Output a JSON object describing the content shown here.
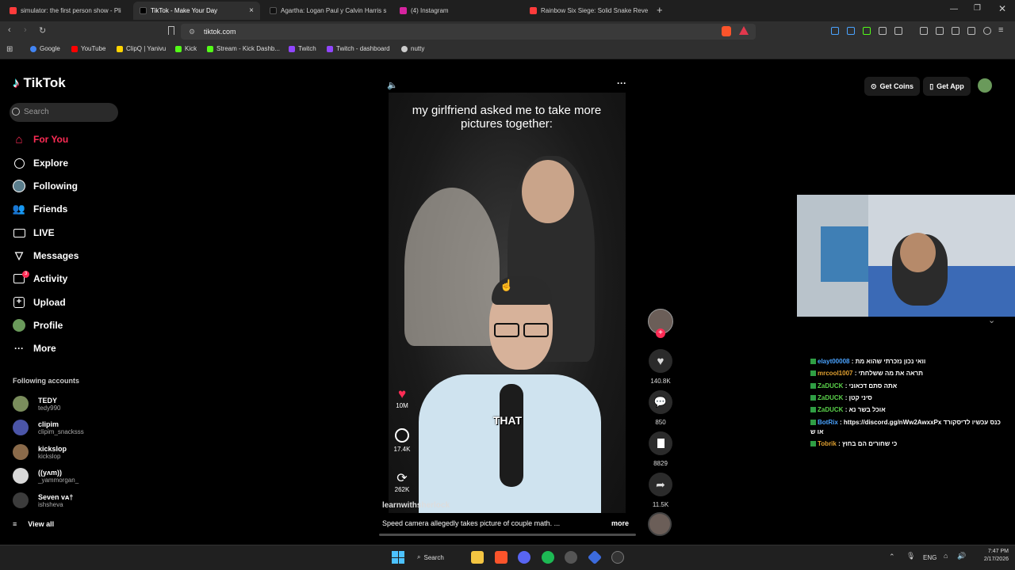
{
  "tabs": [
    {
      "title": "simulator: the first person show - Pli",
      "color": "#ff3b3b"
    },
    {
      "title": "TikTok - Make Your Day",
      "color": "#111"
    },
    {
      "title": "Agartha: Logan Paul y Calvin Harris s",
      "color": "#111"
    },
    {
      "title": "(4) Instagram",
      "color": "#d6249f"
    },
    {
      "title": "Rainbow Six Siege: Solid Snake Reve",
      "color": "#ff3b3b"
    }
  ],
  "tab_close": "×",
  "new_tab": "+",
  "address": {
    "url": "tiktok.com"
  },
  "bookmarks": [
    {
      "label": "Google",
      "color": "#4285f4"
    },
    {
      "label": "YouTube",
      "color": "#ff0000"
    },
    {
      "label": "ClipQ | Yanivu",
      "color": "#ffd400"
    },
    {
      "label": "Kick",
      "color": "#53fc18"
    },
    {
      "label": "Stream - Kick Dashb...",
      "color": "#53fc18"
    },
    {
      "label": "Twitch",
      "color": "#9146ff"
    },
    {
      "label": "Twitch - dashboard",
      "color": "#9146ff"
    },
    {
      "label": "nutty",
      "color": "#cccccc"
    }
  ],
  "tiktok": {
    "logo": "TikTok",
    "search_placeholder": "Search",
    "nav": [
      {
        "label": "For You",
        "icon": "home-icon",
        "active": true
      },
      {
        "label": "Explore",
        "icon": "compass-icon"
      },
      {
        "label": "Following",
        "icon": "following-avatar-icon"
      },
      {
        "label": "Friends",
        "icon": "friends-icon"
      },
      {
        "label": "LIVE",
        "icon": "live-icon"
      },
      {
        "label": "Messages",
        "icon": "messages-icon"
      },
      {
        "label": "Activity",
        "icon": "activity-icon",
        "badge": "3"
      },
      {
        "label": "Upload",
        "icon": "upload-icon"
      },
      {
        "label": "Profile",
        "icon": "profile-avatar-icon"
      },
      {
        "label": "More",
        "icon": "more-icon"
      }
    ],
    "following_title": "Following accounts",
    "following": [
      {
        "name": "TEDY",
        "handle": "tedy990"
      },
      {
        "name": "clipim",
        "handle": "clipim_snacksss"
      },
      {
        "name": "kickslop",
        "handle": "kickslop"
      },
      {
        "name": "((yʌm))",
        "handle": "_yammorgan_"
      },
      {
        "name": "Seven ᴠᴀ†",
        "handle": "ishsheva"
      }
    ],
    "view_all": "View all",
    "get_coins": "Get Coins",
    "get_app": "Get App",
    "video": {
      "caption_top": "my girlfriend asked me to take more pictures together:",
      "overlay_word": "THAT",
      "author": "learnwithsherlock",
      "description": "Speed camera allegedly takes picture of couple math. ...",
      "more": "more",
      "left_stats": {
        "likes": "10M",
        "comments": "17.4K",
        "reposts": "262K"
      },
      "right_stats": {
        "likes": "140.8K",
        "comments": "850",
        "saves": "8829",
        "shares": "11.5K"
      }
    }
  },
  "chat": [
    {
      "user": "elayt00008",
      "msg": ": וואי נכון נזכרתי שהוא מת",
      "user_color": "#4aa3ff"
    },
    {
      "user": "mrcool1007",
      "msg": ": תראה את מה ששלחתי",
      "user_color": "#e0a030"
    },
    {
      "user": "ZaDUCK",
      "msg": ": אתה סתם דכאוני",
      "user_color": "#5ad14a"
    },
    {
      "user": "ZaDUCK",
      "msg": ": סיני קטן",
      "user_color": "#5ad14a"
    },
    {
      "user": "ZaDUCK",
      "msg": ": אוכל בשר נא",
      "user_color": "#5ad14a"
    },
    {
      "user": "BotRix",
      "msg": ": https://discord.gg/nWw2AwxxPx כנס עכשיו לדיסקורד",
      "user_color": "#4aa3ff"
    },
    {
      "user": "",
      "msg": "או ש",
      "user_color": "#ffffff"
    },
    {
      "user": "Tobrik",
      "msg": ": כי שחורים הם בחוץ",
      "user_color": "#e0a030"
    }
  ],
  "taskbar": {
    "search": "Search",
    "lang": "ENG",
    "time": "7:47 PM",
    "date": "2/17/2026"
  }
}
